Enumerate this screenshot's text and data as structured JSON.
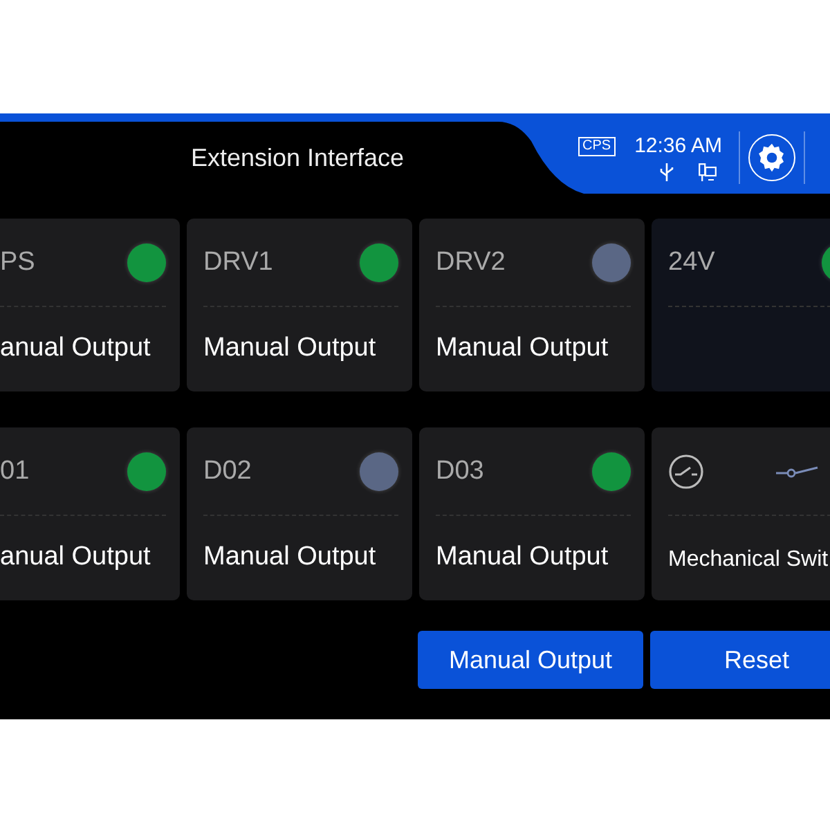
{
  "header": {
    "title": "Extension Interface",
    "badge": "CPS",
    "time": "12:36 AM"
  },
  "cards": [
    {
      "kind": "output",
      "label": "PS",
      "color": "#12943f",
      "mode": "anual Output"
    },
    {
      "kind": "output",
      "label": "DRV1",
      "color": "#12943f",
      "mode": "Manual Output"
    },
    {
      "kind": "output",
      "label": "DRV2",
      "color": "#5a6785",
      "mode": "Manual Output"
    },
    {
      "kind": "supply",
      "label": "24V",
      "color": "#12943f"
    },
    {
      "kind": "output",
      "label": "01",
      "color": "#12943f",
      "mode": "anual Output"
    },
    {
      "kind": "output",
      "label": "D02",
      "color": "#5a6785",
      "mode": "Manual Output"
    },
    {
      "kind": "output",
      "label": "D03",
      "color": "#12943f",
      "mode": "Manual Output"
    },
    {
      "kind": "switch",
      "mode": "Mechanical Swit"
    }
  ],
  "buttons": [
    "Manual Output",
    "Reset"
  ]
}
